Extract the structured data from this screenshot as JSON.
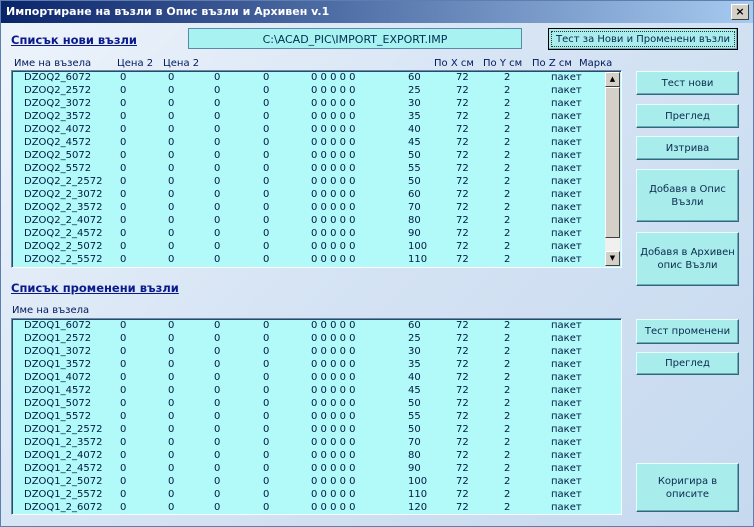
{
  "window": {
    "title": "Импортиране на възли в Опис възли и Архивен v.1",
    "close_label": "×"
  },
  "new_list": {
    "title": "Списък нови възли",
    "path": "C:\\ACAD_PIC\\IMPORT_EXPORT.IMP",
    "headers": {
      "name": "Име на възела",
      "price2a": "Цена 2",
      "price2b": "Цена 2",
      "x": "По X см",
      "y": "По Y см",
      "z": "По Z см",
      "mark": "Марка"
    },
    "rows": [
      [
        "DZOQ2_6072",
        "0",
        "0",
        "0",
        "0",
        "0 0 0 0 0",
        "60",
        "72",
        "2",
        "пакет"
      ],
      [
        "DZOQ2_2572",
        "0",
        "0",
        "0",
        "0",
        "0 0 0 0 0",
        "25",
        "72",
        "2",
        "пакет"
      ],
      [
        "DZOQ2_3072",
        "0",
        "0",
        "0",
        "0",
        "0 0 0 0 0",
        "30",
        "72",
        "2",
        "пакет"
      ],
      [
        "DZOQ2_3572",
        "0",
        "0",
        "0",
        "0",
        "0 0 0 0 0",
        "35",
        "72",
        "2",
        "пакет"
      ],
      [
        "DZOQ2_4072",
        "0",
        "0",
        "0",
        "0",
        "0 0 0 0 0",
        "40",
        "72",
        "2",
        "пакет"
      ],
      [
        "DZOQ2_4572",
        "0",
        "0",
        "0",
        "0",
        "0 0 0 0 0",
        "45",
        "72",
        "2",
        "пакет"
      ],
      [
        "DZOQ2_5072",
        "0",
        "0",
        "0",
        "0",
        "0 0 0 0 0",
        "50",
        "72",
        "2",
        "пакет"
      ],
      [
        "DZOQ2_5572",
        "0",
        "0",
        "0",
        "0",
        "0 0 0 0 0",
        "55",
        "72",
        "2",
        "пакет"
      ],
      [
        "DZOQ2_2_2572",
        "0",
        "0",
        "0",
        "0",
        "0 0 0 0 0",
        "50",
        "72",
        "2",
        "пакет"
      ],
      [
        "DZOQ2_2_3072",
        "0",
        "0",
        "0",
        "0",
        "0 0 0 0 0",
        "60",
        "72",
        "2",
        "пакет"
      ],
      [
        "DZOQ2_2_3572",
        "0",
        "0",
        "0",
        "0",
        "0 0 0 0 0",
        "70",
        "72",
        "2",
        "пакет"
      ],
      [
        "DZOQ2_2_4072",
        "0",
        "0",
        "0",
        "0",
        "0 0 0 0 0",
        "80",
        "72",
        "2",
        "пакет"
      ],
      [
        "DZOQ2_2_4572",
        "0",
        "0",
        "0",
        "0",
        "0 0 0 0 0",
        "90",
        "72",
        "2",
        "пакет"
      ],
      [
        "DZOQ2_2_5072",
        "0",
        "0",
        "0",
        "0",
        "0 0 0 0 0",
        "100",
        "72",
        "2",
        "пакет"
      ],
      [
        "DZOQ2_2_5572",
        "0",
        "0",
        "0",
        "0",
        "0 0 0 0 0",
        "110",
        "72",
        "2",
        "пакет"
      ]
    ]
  },
  "changed_list": {
    "title": "Списък променени възли",
    "headers": {
      "name": "Име на възела"
    },
    "rows": [
      [
        "DZOQ1_6072",
        "0",
        "0",
        "0",
        "0",
        "0 0 0 0 0",
        "60",
        "72",
        "2",
        "пакет"
      ],
      [
        "DZOQ1_2572",
        "0",
        "0",
        "0",
        "0",
        "0 0 0 0 0",
        "25",
        "72",
        "2",
        "пакет"
      ],
      [
        "DZOQ1_3072",
        "0",
        "0",
        "0",
        "0",
        "0 0 0 0 0",
        "30",
        "72",
        "2",
        "пакет"
      ],
      [
        "DZOQ1_3572",
        "0",
        "0",
        "0",
        "0",
        "0 0 0 0 0",
        "35",
        "72",
        "2",
        "пакет"
      ],
      [
        "DZOQ1_4072",
        "0",
        "0",
        "0",
        "0",
        "0 0 0 0 0",
        "40",
        "72",
        "2",
        "пакет"
      ],
      [
        "DZOQ1_4572",
        "0",
        "0",
        "0",
        "0",
        "0 0 0 0 0",
        "45",
        "72",
        "2",
        "пакет"
      ],
      [
        "DZOQ1_5072",
        "0",
        "0",
        "0",
        "0",
        "0 0 0 0 0",
        "50",
        "72",
        "2",
        "пакет"
      ],
      [
        "DZOQ1_5572",
        "0",
        "0",
        "0",
        "0",
        "0 0 0 0 0",
        "55",
        "72",
        "2",
        "пакет"
      ],
      [
        "DZOQ1_2_2572",
        "0",
        "0",
        "0",
        "0",
        "0 0 0 0 0",
        "50",
        "72",
        "2",
        "пакет"
      ],
      [
        "DZOQ1_2_3572",
        "0",
        "0",
        "0",
        "0",
        "0 0 0 0 0",
        "70",
        "72",
        "2",
        "пакет"
      ],
      [
        "DZOQ1_2_4072",
        "0",
        "0",
        "0",
        "0",
        "0 0 0 0 0",
        "80",
        "72",
        "2",
        "пакет"
      ],
      [
        "DZOQ1_2_4572",
        "0",
        "0",
        "0",
        "0",
        "0 0 0 0 0",
        "90",
        "72",
        "2",
        "пакет"
      ],
      [
        "DZOQ1_2_5072",
        "0",
        "0",
        "0",
        "0",
        "0 0 0 0 0",
        "100",
        "72",
        "2",
        "пакет"
      ],
      [
        "DZOQ1_2_5572",
        "0",
        "0",
        "0",
        "0",
        "0 0 0 0 0",
        "110",
        "72",
        "2",
        "пакет"
      ],
      [
        "DZOQ1_2_6072",
        "0",
        "0",
        "0",
        "0",
        "0 0 0 0 0",
        "120",
        "72",
        "2",
        "пакет"
      ]
    ]
  },
  "buttons": {
    "test_new_changed": "Тест за Нови и Променени възли",
    "test_new": "Тест нови",
    "preview_new": "Преглед",
    "delete": "Изтрива",
    "add_to_list": "Добавя в Опис Възли",
    "add_to_archive": "Добавя в Архивен опис Възли",
    "test_changed": "Тест променени",
    "preview_changed": "Преглед",
    "correct_lists": "Коригира в описите"
  },
  "colors": {
    "list_bg": "#b2fafa",
    "button_bg": "#a9ecec",
    "title_link": "#0a1a8c",
    "titlebar": "#0a246a"
  }
}
